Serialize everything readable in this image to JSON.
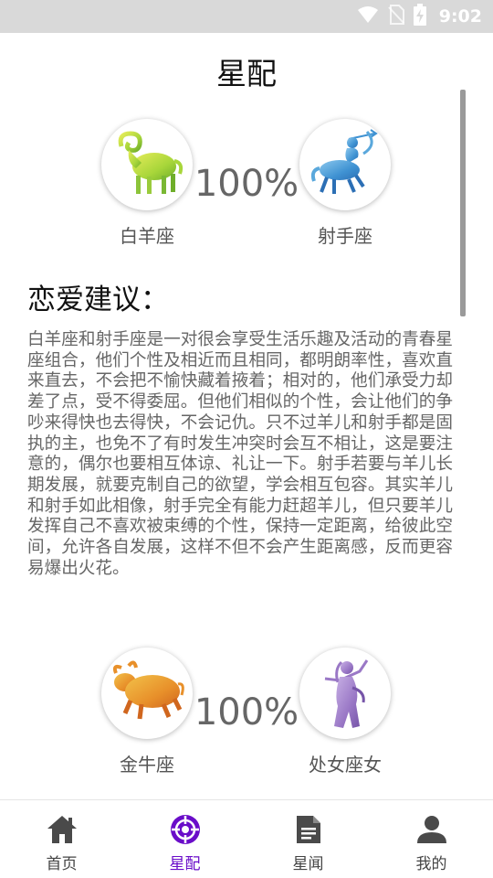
{
  "status_bar": {
    "time": "9:02",
    "icons": [
      "wifi-icon",
      "no-sim-icon",
      "battery-charging-icon"
    ]
  },
  "header": {
    "title": "星配"
  },
  "matches": [
    {
      "left_sign": {
        "name": "白羊座",
        "icon": "aries-icon",
        "color": "#b7d84a"
      },
      "right_sign": {
        "name": "射手座",
        "icon": "sagittarius-icon",
        "color": "#4aa0d8"
      },
      "percent": "100%"
    },
    {
      "left_sign": {
        "name": "金牛座",
        "icon": "taurus-icon",
        "color": "#e89a2a"
      },
      "right_sign": {
        "name": "处女座女",
        "icon": "virgo-icon",
        "color": "#9a78c6"
      },
      "percent": "100%"
    }
  ],
  "advice": {
    "heading": "恋爱建议：",
    "text": "白羊座和射手座是一对很会享受生活乐趣及活动的青春星座组合，他们个性及相近而且相同，都明朗率性，喜欢直来直去，不会把不愉快藏着掖着；相对的，他们承受力却差了点，受不得委屈。但他们相似的个性，会让他们的争吵来得快也去得快，不会记仇。只不过羊儿和射手都是固执的主，也免不了有时发生冲突时会互不相让，这是要注意的，偶尔也要相互体谅、礼让一下。射手若要与羊儿长期发展，就要克制自己的欲望，学会相互包容。其实羊儿和射手如此相像，射手完全有能力赶超羊儿，但只要羊儿发挥自己不喜欢被束缚的个性，保持一定距离，给彼此空间，允许各自发展，这样不但不会产生距离感，反而更容易爆出火花。"
  },
  "bottom_nav": {
    "items": [
      {
        "label": "首页",
        "icon": "home-icon",
        "active": false
      },
      {
        "label": "星配",
        "icon": "target-icon",
        "active": true
      },
      {
        "label": "星闻",
        "icon": "document-icon",
        "active": false
      },
      {
        "label": "我的",
        "icon": "person-icon",
        "active": false
      }
    ],
    "active_color": "#6a0dc9",
    "inactive_color": "#444444"
  }
}
